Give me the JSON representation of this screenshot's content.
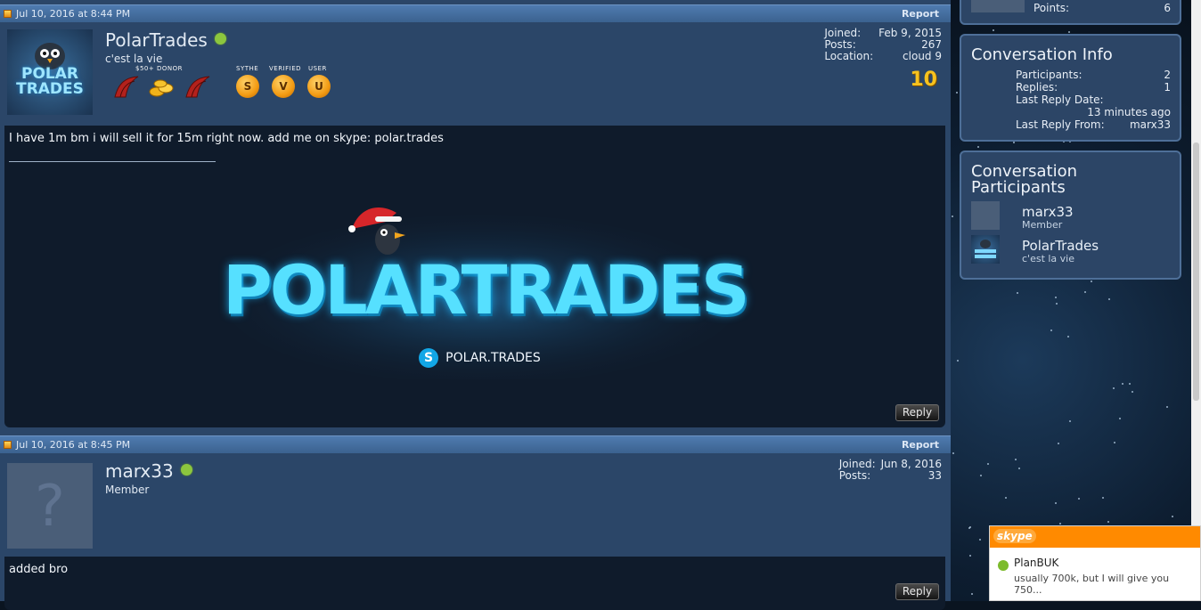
{
  "posts": [
    {
      "date": "Jul 10, 2016 at 8:44 PM",
      "report_label": "Report",
      "username": "PolarTrades",
      "user_title": "c'est la vie",
      "avatar_text": [
        "POLAR",
        "TRADES"
      ],
      "badges": {
        "donor_label": "$50+ DONOR",
        "sythe_label": "SYTHE",
        "verified_label": "VERIFIED",
        "user_label": "USER",
        "coin_letters": [
          "S",
          "V",
          "U"
        ]
      },
      "stats": [
        {
          "label": "Joined:",
          "value": "Feb 9, 2015"
        },
        {
          "label": "Posts:",
          "value": "267"
        },
        {
          "label": "Location:",
          "value": "cloud 9"
        }
      ],
      "anniversary_badge": "10",
      "message": "I have 1m bm i will sell it for 15m right now. add me on skype: polar.trades",
      "signature": {
        "banner_text": "POLARTRADES",
        "skype_handle": "POLAR.TRADES"
      },
      "reply_label": "Reply"
    },
    {
      "date": "Jul 10, 2016 at 8:45 PM",
      "report_label": "Report",
      "username": "marx33",
      "user_title": "Member",
      "stats": [
        {
          "label": "Joined:",
          "value": "Jun 8, 2016"
        },
        {
          "label": "Posts:",
          "value": "33"
        }
      ],
      "message": "added bro",
      "reply_label": "Reply"
    }
  ],
  "sidebar": {
    "points": {
      "label": "Points:",
      "value": "6"
    },
    "conversation_info": {
      "title": "Conversation Info",
      "participants": {
        "label": "Participants:",
        "value": "2"
      },
      "replies": {
        "label": "Replies:",
        "value": "1"
      },
      "last_reply_date": {
        "label": "Last Reply Date:",
        "value": "13 minutes ago"
      },
      "last_reply_from": {
        "label": "Last Reply From:",
        "value": "marx33"
      }
    },
    "conversation_participants": {
      "title_line1": "Conversation",
      "title_line2": "Participants",
      "members": [
        {
          "name": "marx33",
          "title": "Member"
        },
        {
          "name": "PolarTrades",
          "title": "c'est la vie"
        }
      ]
    }
  },
  "skype_toast": {
    "brand": "skype",
    "contact": "PlanBUK",
    "message": "usually 700k, but I will give you 750..."
  },
  "colors": {
    "header_blue": "#4f7bb0",
    "post_bg": "#2b4668",
    "body_dark": "#0f1b2b",
    "online_green": "#8cc63e",
    "skype_orange": "#ff8a00"
  }
}
